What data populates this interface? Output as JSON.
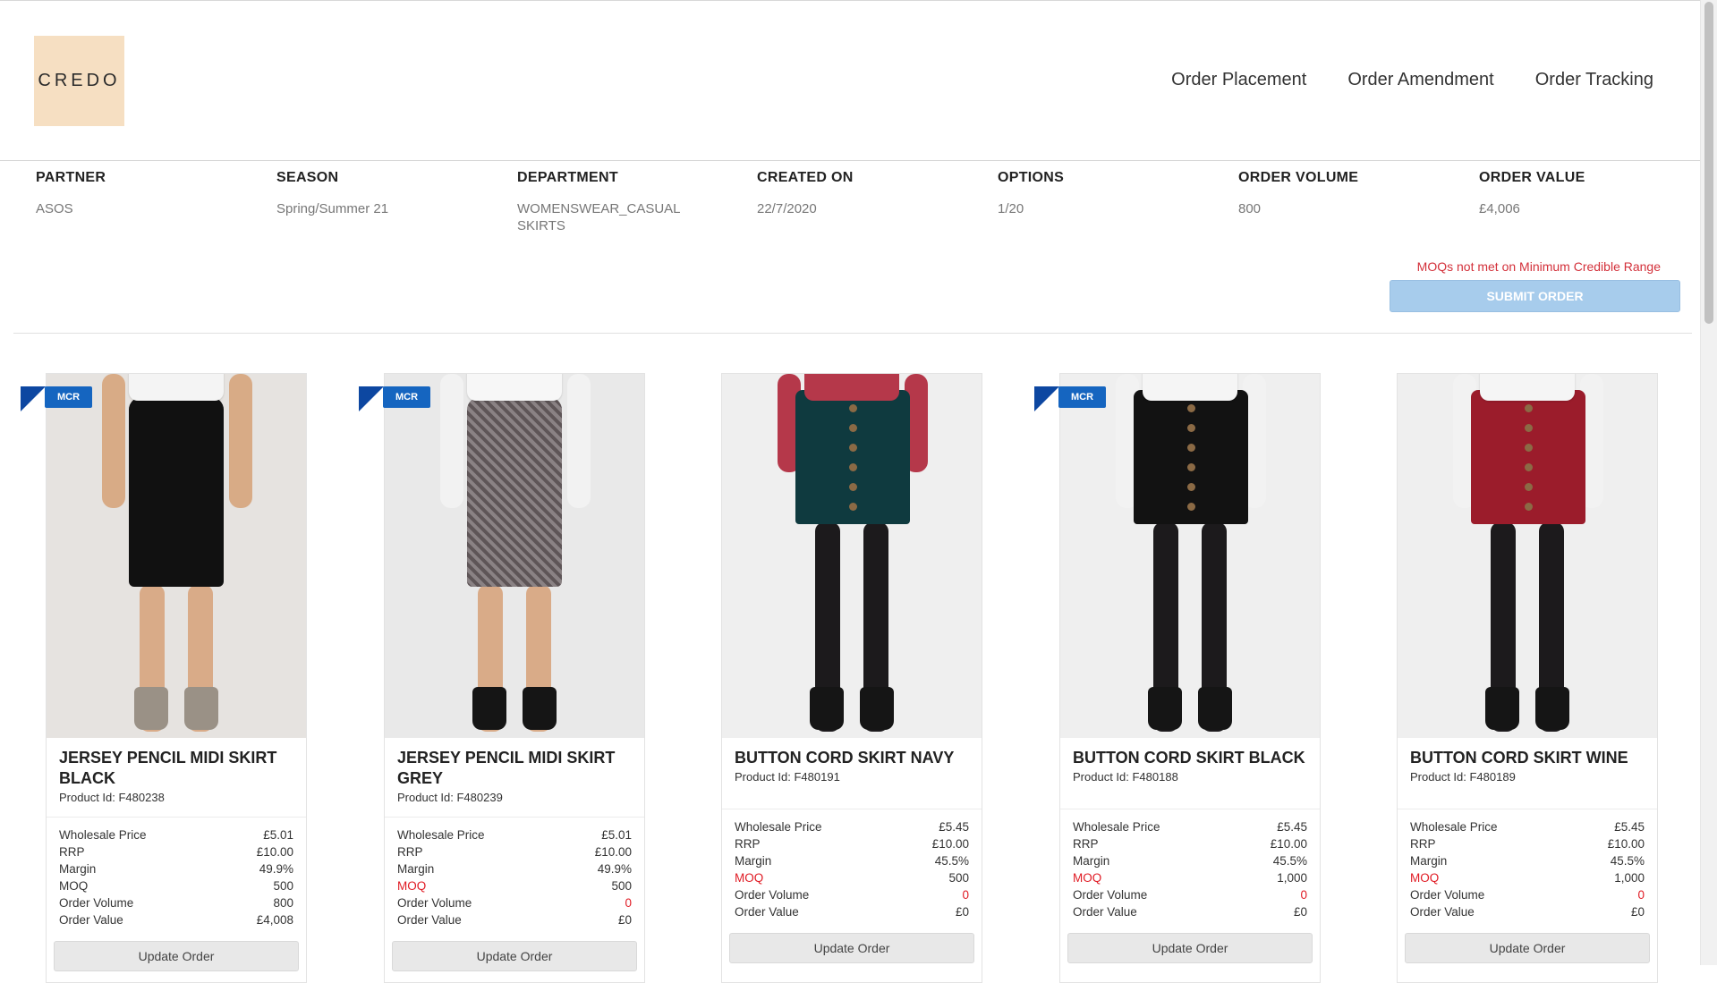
{
  "brand": {
    "logo_text": "CREDO"
  },
  "nav": {
    "items": [
      "Order Placement",
      "Order Amendment",
      "Order Tracking"
    ]
  },
  "order_info": [
    {
      "label": "PARTNER",
      "value": "ASOS"
    },
    {
      "label": "SEASON",
      "value": "Spring/Summer 21"
    },
    {
      "label": "DEPARTMENT",
      "value": "WOMENSWEAR_CASUAL SKIRTS"
    },
    {
      "label": "CREATED ON",
      "value": "22/7/2020"
    },
    {
      "label": "OPTIONS",
      "value": "1/20"
    },
    {
      "label": "ORDER VOLUME",
      "value": "800"
    },
    {
      "label": "ORDER VALUE",
      "value": "£4,006"
    }
  ],
  "warning": "MOQs not met on Minimum Credible Range",
  "submit_label": "SUBMIT ORDER",
  "stat_labels": {
    "wholesale": "Wholesale Price",
    "rrp": "RRP",
    "margin": "Margin",
    "moq": "MOQ",
    "volume": "Order Volume",
    "value": "Order Value"
  },
  "update_label": "Update Order",
  "mcr_label": "MCR",
  "products": [
    {
      "name": "JERSEY PENCIL MIDI SKIRT BLACK",
      "product_id": "Product Id: F480238",
      "mcr": true,
      "wholesale": "£5.01",
      "rrp": "£10.00",
      "margin": "49.9%",
      "moq": "500",
      "volume": "800",
      "value": "£4,008",
      "moq_alert": false,
      "skirt_color": "#111111",
      "top_color": "#f4f4f4",
      "skirt_style": "midi",
      "legs": "bare"
    },
    {
      "name": "JERSEY PENCIL MIDI SKIRT GREY",
      "product_id": "Product Id: F480239",
      "mcr": true,
      "wholesale": "£5.01",
      "rrp": "£10.00",
      "margin": "49.9%",
      "moq": "500",
      "volume": "0",
      "value": "£0",
      "moq_alert": true,
      "skirt_color": "#6e6466",
      "top_color": "#f7f7f7",
      "skirt_style": "midi",
      "legs": "bare"
    },
    {
      "name": "BUTTON CORD SKIRT NAVY",
      "product_id": "Product Id: F480191",
      "mcr": false,
      "wholesale": "£5.45",
      "rrp": "£10.00",
      "margin": "45.5%",
      "moq": "500",
      "volume": "0",
      "value": "£0",
      "moq_alert": true,
      "skirt_color": "#0f3a3f",
      "top_color": "#b5384a",
      "skirt_style": "mini",
      "legs": "tights"
    },
    {
      "name": "BUTTON CORD SKIRT BLACK",
      "product_id": "Product Id: F480188",
      "mcr": true,
      "wholesale": "£5.45",
      "rrp": "£10.00",
      "margin": "45.5%",
      "moq": "1,000",
      "volume": "0",
      "value": "£0",
      "moq_alert": true,
      "skirt_color": "#121212",
      "top_color": "#f5f5f5",
      "skirt_style": "mini",
      "legs": "tights"
    },
    {
      "name": "BUTTON CORD SKIRT WINE",
      "product_id": "Product Id: F480189",
      "mcr": false,
      "wholesale": "£5.45",
      "rrp": "£10.00",
      "margin": "45.5%",
      "moq": "1,000",
      "volume": "0",
      "value": "£0",
      "moq_alert": true,
      "skirt_color": "#9b1c2b",
      "top_color": "#f5f5f5",
      "skirt_style": "mini",
      "legs": "tights"
    }
  ]
}
